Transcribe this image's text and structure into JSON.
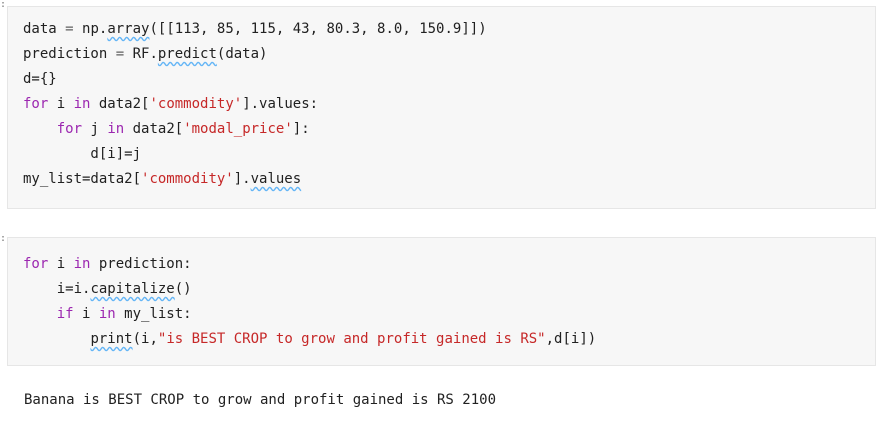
{
  "cells": [
    {
      "gutter": ":",
      "lines": [
        [
          {
            "t": "data "
          },
          {
            "t": "=",
            "c": "op"
          },
          {
            "t": " np."
          },
          {
            "t": "array",
            "c": "squig"
          },
          {
            "t": "([[113, 85, 115, 43, 80.3, 8.0, 150.9]])"
          }
        ],
        [
          {
            "t": "prediction "
          },
          {
            "t": "=",
            "c": "op"
          },
          {
            "t": " RF."
          },
          {
            "t": "predict",
            "c": "squig"
          },
          {
            "t": "(data)"
          }
        ],
        [
          {
            "t": "d={}"
          }
        ],
        [
          {
            "t": "for",
            "c": "kw"
          },
          {
            "t": " i "
          },
          {
            "t": "in",
            "c": "kw"
          },
          {
            "t": " data2["
          },
          {
            "t": "'commodity'",
            "c": "str"
          },
          {
            "t": "].values:"
          }
        ],
        [
          {
            "t": "    "
          },
          {
            "t": "for",
            "c": "kw"
          },
          {
            "t": " j "
          },
          {
            "t": "in",
            "c": "kw"
          },
          {
            "t": " data2["
          },
          {
            "t": "'modal_price'",
            "c": "str"
          },
          {
            "t": "]:"
          }
        ],
        [
          {
            "t": "        d[i]=j"
          }
        ],
        [
          {
            "t": "my_list=data2["
          },
          {
            "t": "'commodity'",
            "c": "str"
          },
          {
            "t": "]."
          },
          {
            "t": "values",
            "c": "squig"
          }
        ]
      ]
    },
    {
      "gutter": ":",
      "lines": [
        [
          {
            "t": "for",
            "c": "kw"
          },
          {
            "t": " i "
          },
          {
            "t": "in",
            "c": "kw"
          },
          {
            "t": " prediction:"
          }
        ],
        [
          {
            "t": "    i=i."
          },
          {
            "t": "capitalize",
            "c": "squig"
          },
          {
            "t": "()"
          }
        ],
        [
          {
            "t": "    "
          },
          {
            "t": "if",
            "c": "kw"
          },
          {
            "t": " i "
          },
          {
            "t": "in",
            "c": "kw"
          },
          {
            "t": " my_list:"
          }
        ],
        [
          {
            "t": "        "
          },
          {
            "t": "print",
            "c": "squig"
          },
          {
            "t": "(i,"
          },
          {
            "t": "\"is BEST CROP to grow and profit gained is RS\"",
            "c": "str"
          },
          {
            "t": ",d[i])"
          }
        ]
      ]
    }
  ],
  "output": {
    "text": "Banana is BEST CROP to grow and profit gained is RS 2100"
  }
}
